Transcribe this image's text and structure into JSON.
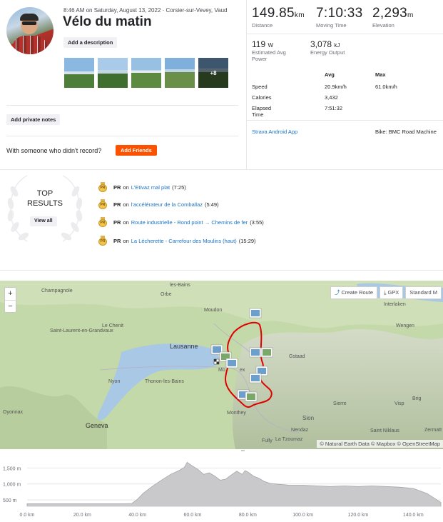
{
  "activity": {
    "meta": "8:46 AM on Saturday, August 13, 2022 · Corsier-sur-Vevey, Vaud",
    "title": "Vélo du matin",
    "add_description": "Add a description",
    "photos_more": "+8",
    "add_private_notes": "Add private notes",
    "with_someone": "With someone who didn't record?",
    "add_friends": "Add Friends"
  },
  "stats": {
    "distance": {
      "value": "149.85",
      "unit": "km",
      "label": "Distance"
    },
    "moving_time": {
      "value": "7:10:33",
      "label": "Moving Time"
    },
    "elevation": {
      "value": "2,293",
      "unit": "m",
      "label": "Elevation"
    },
    "power": {
      "value": "119",
      "unit": "W",
      "label": "Estimated Avg Power"
    },
    "energy": {
      "value": "3,078",
      "unit": "kJ",
      "label": "Energy Output"
    }
  },
  "details": {
    "avg_header": "Avg",
    "max_header": "Max",
    "speed_label": "Speed",
    "speed_avg": "20.9km/h",
    "speed_max": "61.0km/h",
    "calories_label": "Calories",
    "calories_avg": "3,432",
    "elapsed_label": "Elapsed Time",
    "elapsed_avg": "7:51:32",
    "device": "Strava Android App",
    "bike": "Bike: BMC Road Machine"
  },
  "top_results": {
    "title": "TOP RESULTS",
    "view_all": "View all",
    "items": [
      {
        "badge": "PR",
        "on": "on",
        "segment": "L'Etivaz mal plat",
        "time": "(7:25)"
      },
      {
        "badge": "PR",
        "on": "on",
        "segment": "l'accélérateur de la Comballaz",
        "time": "(5:49)"
      },
      {
        "badge": "PR",
        "on": "on",
        "segment": "Route industrielle - Rond point → Chemins de fer",
        "time": "(3:55)"
      },
      {
        "badge": "PR",
        "on": "on",
        "segment": "La Lécherette - Carrefour des Moulins (haut)",
        "time": "(15:29)"
      }
    ]
  },
  "map": {
    "zoom_in": "+",
    "zoom_out": "−",
    "create_route": "Create Route",
    "gpx": "GPX",
    "standard": "Standard M",
    "attribution": "© Natural Earth Data © Mapbox © OpenStreetMap",
    "places": [
      {
        "name": "les-Bains"
      },
      {
        "name": "Champagnole"
      },
      {
        "name": "Orbe"
      },
      {
        "name": "Moudon"
      },
      {
        "name": "Interlaken"
      },
      {
        "name": "Le Chenit"
      },
      {
        "name": "Saint-Laurent-en-Grandvaux"
      },
      {
        "name": "Lausanne"
      },
      {
        "name": "Wengen"
      },
      {
        "name": "Gstaad"
      },
      {
        "name": "Nyon"
      },
      {
        "name": "Thonon-les-Bains"
      },
      {
        "name": "Brig"
      },
      {
        "name": "Oyonnax"
      },
      {
        "name": "Sierre"
      },
      {
        "name": "Visp"
      },
      {
        "name": "Monthey"
      },
      {
        "name": "Sion"
      },
      {
        "name": "Geneva"
      },
      {
        "name": "Nendaz"
      },
      {
        "name": "Zermatt"
      },
      {
        "name": "Saint Niklaus"
      },
      {
        "name": "Fully"
      },
      {
        "name": "La Tzoumaz"
      },
      {
        "name": "Mo"
      },
      {
        "name": "ex"
      }
    ]
  },
  "elevation_profile": {
    "y_ticks": [
      "1,500 m",
      "1,000 m",
      "500 m"
    ],
    "y_values": [
      1500,
      1000,
      500
    ],
    "x_ticks": [
      "0.0 km",
      "20.0 km",
      "40.0 km",
      "60.0 km",
      "80.0 km",
      "100.0 km",
      "120.0 km",
      "140.0 km"
    ],
    "x_values": [
      0,
      20,
      40,
      60,
      80,
      100,
      120,
      140
    ],
    "x_max": 150,
    "y_min": 300,
    "y_max": 1800,
    "profile": [
      [
        0,
        380
      ],
      [
        5,
        380
      ],
      [
        10,
        380
      ],
      [
        15,
        380
      ],
      [
        20,
        380
      ],
      [
        25,
        380
      ],
      [
        30,
        380
      ],
      [
        35,
        380
      ],
      [
        38,
        390
      ],
      [
        40,
        520
      ],
      [
        42,
        700
      ],
      [
        45,
        900
      ],
      [
        48,
        1080
      ],
      [
        52,
        1300
      ],
      [
        55,
        1420
      ],
      [
        57,
        1520
      ],
      [
        58,
        1680
      ],
      [
        60,
        1560
      ],
      [
        62,
        1450
      ],
      [
        64,
        1300
      ],
      [
        66,
        1350
      ],
      [
        68,
        1250
      ],
      [
        70,
        1120
      ],
      [
        72,
        1150
      ],
      [
        74,
        1280
      ],
      [
        76,
        1400
      ],
      [
        78,
        1300
      ],
      [
        79,
        1420
      ],
      [
        80,
        1380
      ],
      [
        82,
        1250
      ],
      [
        84,
        1180
      ],
      [
        86,
        1080
      ],
      [
        88,
        1020
      ],
      [
        90,
        1000
      ],
      [
        95,
        960
      ],
      [
        100,
        960
      ],
      [
        105,
        940
      ],
      [
        110,
        920
      ],
      [
        115,
        940
      ],
      [
        120,
        920
      ],
      [
        125,
        940
      ],
      [
        130,
        920
      ],
      [
        135,
        900
      ],
      [
        140,
        860
      ],
      [
        145,
        700
      ],
      [
        150,
        420
      ]
    ],
    "colors": {
      "fill": "#c9c9cc",
      "line": "#a6a6ab",
      "grid": "#e6e6eb"
    }
  }
}
